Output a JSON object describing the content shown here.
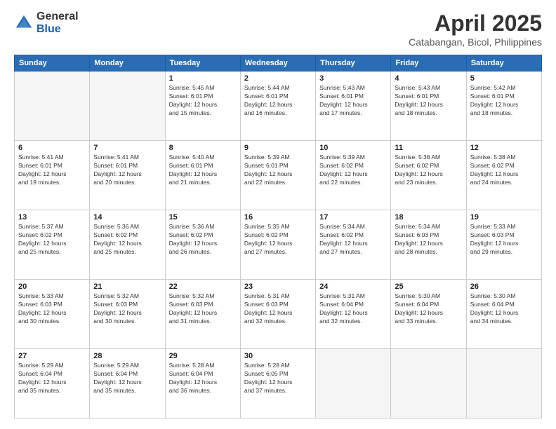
{
  "header": {
    "logo": {
      "general": "General",
      "blue": "Blue"
    },
    "title": "April 2025",
    "location": "Catabangan, Bicol, Philippines"
  },
  "weekdays": [
    "Sunday",
    "Monday",
    "Tuesday",
    "Wednesday",
    "Thursday",
    "Friday",
    "Saturday"
  ],
  "weeks": [
    [
      {
        "day": "",
        "info": ""
      },
      {
        "day": "",
        "info": ""
      },
      {
        "day": "1",
        "info": "Sunrise: 5:45 AM\nSunset: 6:01 PM\nDaylight: 12 hours\nand 15 minutes."
      },
      {
        "day": "2",
        "info": "Sunrise: 5:44 AM\nSunset: 6:01 PM\nDaylight: 12 hours\nand 16 minutes."
      },
      {
        "day": "3",
        "info": "Sunrise: 5:43 AM\nSunset: 6:01 PM\nDaylight: 12 hours\nand 17 minutes."
      },
      {
        "day": "4",
        "info": "Sunrise: 5:43 AM\nSunset: 6:01 PM\nDaylight: 12 hours\nand 18 minutes."
      },
      {
        "day": "5",
        "info": "Sunrise: 5:42 AM\nSunset: 6:01 PM\nDaylight: 12 hours\nand 18 minutes."
      }
    ],
    [
      {
        "day": "6",
        "info": "Sunrise: 5:41 AM\nSunset: 6:01 PM\nDaylight: 12 hours\nand 19 minutes."
      },
      {
        "day": "7",
        "info": "Sunrise: 5:41 AM\nSunset: 6:01 PM\nDaylight: 12 hours\nand 20 minutes."
      },
      {
        "day": "8",
        "info": "Sunrise: 5:40 AM\nSunset: 6:01 PM\nDaylight: 12 hours\nand 21 minutes."
      },
      {
        "day": "9",
        "info": "Sunrise: 5:39 AM\nSunset: 6:01 PM\nDaylight: 12 hours\nand 22 minutes."
      },
      {
        "day": "10",
        "info": "Sunrise: 5:39 AM\nSunset: 6:02 PM\nDaylight: 12 hours\nand 22 minutes."
      },
      {
        "day": "11",
        "info": "Sunrise: 5:38 AM\nSunset: 6:02 PM\nDaylight: 12 hours\nand 23 minutes."
      },
      {
        "day": "12",
        "info": "Sunrise: 5:38 AM\nSunset: 6:02 PM\nDaylight: 12 hours\nand 24 minutes."
      }
    ],
    [
      {
        "day": "13",
        "info": "Sunrise: 5:37 AM\nSunset: 6:02 PM\nDaylight: 12 hours\nand 25 minutes."
      },
      {
        "day": "14",
        "info": "Sunrise: 5:36 AM\nSunset: 6:02 PM\nDaylight: 12 hours\nand 25 minutes."
      },
      {
        "day": "15",
        "info": "Sunrise: 5:36 AM\nSunset: 6:02 PM\nDaylight: 12 hours\nand 26 minutes."
      },
      {
        "day": "16",
        "info": "Sunrise: 5:35 AM\nSunset: 6:02 PM\nDaylight: 12 hours\nand 27 minutes."
      },
      {
        "day": "17",
        "info": "Sunrise: 5:34 AM\nSunset: 6:02 PM\nDaylight: 12 hours\nand 27 minutes."
      },
      {
        "day": "18",
        "info": "Sunrise: 5:34 AM\nSunset: 6:03 PM\nDaylight: 12 hours\nand 28 minutes."
      },
      {
        "day": "19",
        "info": "Sunrise: 5:33 AM\nSunset: 6:03 PM\nDaylight: 12 hours\nand 29 minutes."
      }
    ],
    [
      {
        "day": "20",
        "info": "Sunrise: 5:33 AM\nSunset: 6:03 PM\nDaylight: 12 hours\nand 30 minutes."
      },
      {
        "day": "21",
        "info": "Sunrise: 5:32 AM\nSunset: 6:03 PM\nDaylight: 12 hours\nand 30 minutes."
      },
      {
        "day": "22",
        "info": "Sunrise: 5:32 AM\nSunset: 6:03 PM\nDaylight: 12 hours\nand 31 minutes."
      },
      {
        "day": "23",
        "info": "Sunrise: 5:31 AM\nSunset: 6:03 PM\nDaylight: 12 hours\nand 32 minutes."
      },
      {
        "day": "24",
        "info": "Sunrise: 5:31 AM\nSunset: 6:04 PM\nDaylight: 12 hours\nand 32 minutes."
      },
      {
        "day": "25",
        "info": "Sunrise: 5:30 AM\nSunset: 6:04 PM\nDaylight: 12 hours\nand 33 minutes."
      },
      {
        "day": "26",
        "info": "Sunrise: 5:30 AM\nSunset: 6:04 PM\nDaylight: 12 hours\nand 34 minutes."
      }
    ],
    [
      {
        "day": "27",
        "info": "Sunrise: 5:29 AM\nSunset: 6:04 PM\nDaylight: 12 hours\nand 35 minutes."
      },
      {
        "day": "28",
        "info": "Sunrise: 5:29 AM\nSunset: 6:04 PM\nDaylight: 12 hours\nand 35 minutes."
      },
      {
        "day": "29",
        "info": "Sunrise: 5:28 AM\nSunset: 6:04 PM\nDaylight: 12 hours\nand 36 minutes."
      },
      {
        "day": "30",
        "info": "Sunrise: 5:28 AM\nSunset: 6:05 PM\nDaylight: 12 hours\nand 37 minutes."
      },
      {
        "day": "",
        "info": ""
      },
      {
        "day": "",
        "info": ""
      },
      {
        "day": "",
        "info": ""
      }
    ]
  ]
}
